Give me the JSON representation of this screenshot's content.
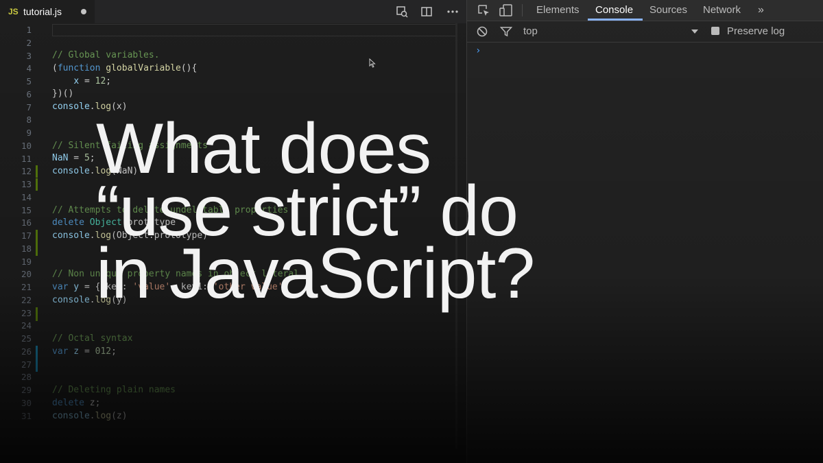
{
  "editor": {
    "tab": {
      "lang": "JS",
      "filename": "tutorial.js"
    },
    "toolbar_icons": [
      "open-changes-icon",
      "split-editor-icon",
      "more-actions-icon"
    ],
    "line_numbers": [
      "1",
      "2",
      "3",
      "4",
      "5",
      "6",
      "7",
      "8",
      "9",
      "10",
      "11",
      "12",
      "13",
      "14",
      "15",
      "16",
      "17",
      "18",
      "19",
      "20",
      "21",
      "22",
      "23",
      "24",
      "25",
      "26",
      "27",
      "28",
      "29",
      "30",
      "31"
    ],
    "code": {
      "l3": "// Global variables.",
      "l4_a": "(",
      "l4_kw": "function",
      "l4_fn": "globalVariable",
      "l4_b": "(){",
      "l5_var": "x",
      "l5_op": " = ",
      "l5_num": "12",
      "l5_end": ";",
      "l6": "})()",
      "l7_obj": "console",
      "l7_dot": ".",
      "l7_fn": "log",
      "l7_rest": "(x)",
      "l10": "// Silent failing assignments",
      "l11_var": "NaN",
      "l11_op": " = ",
      "l11_num": "5",
      "l11_end": ";",
      "l12_obj": "console",
      "l12_dot": ".",
      "l12_fn": "log",
      "l12_rest": "(NaN)",
      "l15": "// Attempts to delete undeletable properties",
      "l16_kw": "delete",
      "l16_cls": " Object",
      "l16_rest": ".prototype",
      "l17_obj": "console",
      "l17_dot": ".",
      "l17_fn": "log",
      "l17_rest": "(Object.prototype)",
      "l20": "// Non unique property names in object literal",
      "l21_kw": "var",
      "l21_var": " y",
      "l21_op": " = { key: ",
      "l21_str": "'value'",
      "l21_mid": ", key1: ",
      "l21_str2": "'other value'",
      "l22_obj": "console",
      "l22_dot": ".",
      "l22_fn": "log",
      "l22_rest": "(y)",
      "l25": "// Octal syntax",
      "l26_kw": "var",
      "l26_var": " z",
      "l26_op": " = ",
      "l26_num": "012",
      "l26_end": ";",
      "l29": "// Deleting plain names",
      "l30_kw": "delete",
      "l30_rest": " z;",
      "l31_obj": "console",
      "l31_dot": ".",
      "l31_fn": "log",
      "l31_rest": "(z)"
    }
  },
  "devtools": {
    "tabs": [
      "Elements",
      "Console",
      "Sources",
      "Network"
    ],
    "active_tab": "Console",
    "more": "»",
    "context": "top",
    "preserve_log": "Preserve log",
    "prompt": "›"
  },
  "headline": {
    "line1": "What does",
    "line2": "“use strict” do",
    "line3": "in JavaScript?"
  },
  "colors": {
    "accent": "#8ab4f8",
    "comment": "#6a9955",
    "keyword": "#569cd6"
  }
}
